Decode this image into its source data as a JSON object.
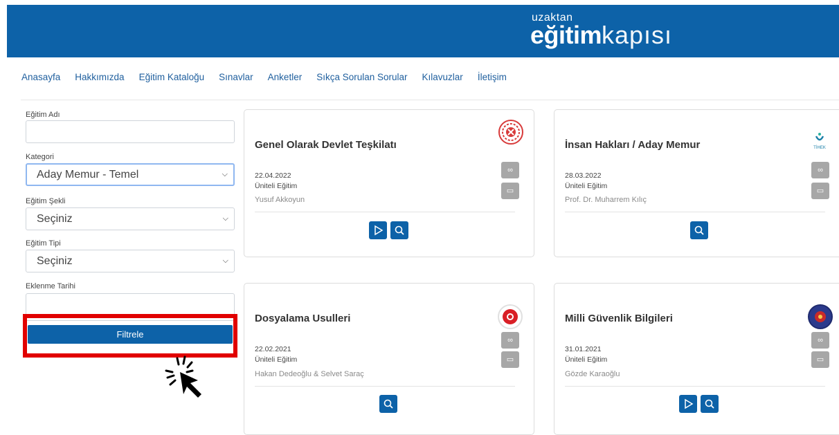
{
  "header": {
    "logo_top": "uzaktan",
    "logo_bold": "eğitim",
    "logo_thin": "kapısı"
  },
  "nav": {
    "items": [
      "Anasayfa",
      "Hakkımızda",
      "Eğitim Kataloğu",
      "Sınavlar",
      "Anketler",
      "Sıkça Sorulan Sorular",
      "Kılavuzlar",
      "İletişim"
    ]
  },
  "filters": {
    "name_label": "Eğitim Adı",
    "name_value": "",
    "category_label": "Kategori",
    "category_value": "Aday Memur - Temel",
    "method_label": "Eğitim Şekli",
    "method_value": "Seçiniz",
    "type_label": "Eğitim Tipi",
    "type_value": "Seçiniz",
    "date_label": "Eklenme Tarihi",
    "date_value": "",
    "filter_button": "Filtrele"
  },
  "cards": [
    {
      "title": "Genel Olarak Devlet Teşkilatı",
      "date": "22.04.2022",
      "type": "Üniteli Eğitim",
      "author": "Yusuf Akkoyun",
      "emblem": "ministry-emblem-icon",
      "actions": [
        "play",
        "search"
      ]
    },
    {
      "title": "İnsan Hakları / Aday Memur",
      "date": "28.03.2022",
      "type": "Üniteli Eğitim",
      "author": "Prof. Dr. Muharrem Kılıç",
      "emblem": "tihek-logo",
      "emblem_text": "TİHEK",
      "actions": [
        "search"
      ]
    },
    {
      "title": "Dosyalama Usulleri",
      "date": "22.02.2021",
      "type": "Üniteli Eğitim",
      "author": "Hakan Dedeoğlu & Selvet Saraç",
      "emblem": "presidency-seal-icon",
      "actions": [
        "search"
      ]
    },
    {
      "title": "Milli Güvenlik Bilgileri",
      "date": "31.01.2021",
      "type": "Üniteli Eğitim",
      "author": "Gözde Karaoğlu",
      "emblem": "security-seal-icon",
      "actions": [
        "play",
        "search"
      ]
    }
  ],
  "colors": {
    "brand": "#0d62a8",
    "highlight": "#e10000",
    "gray_button": "#a7a7a7"
  }
}
